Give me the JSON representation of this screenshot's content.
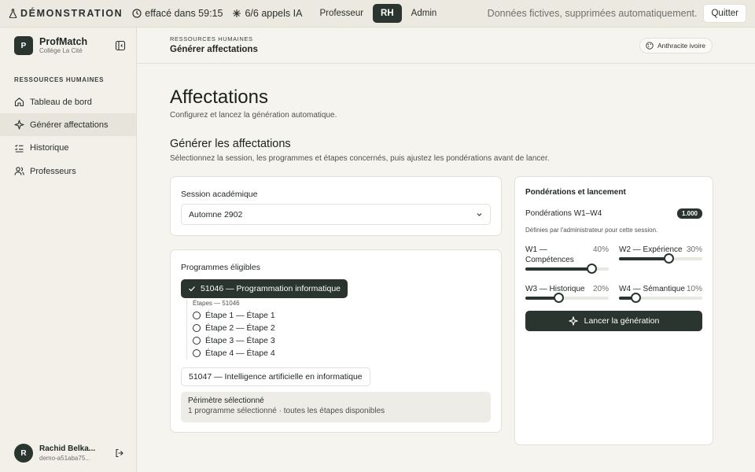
{
  "topbar": {
    "demo_label": "DÉMONSTRATION",
    "timer": "effacé dans 59:15",
    "ai_calls": "6/6 appels IA",
    "roles": [
      "Professeur",
      "RH",
      "Admin"
    ],
    "active_role": "RH",
    "note": "Données fictives, supprimées automatiquement.",
    "quit_label": "Quitter"
  },
  "brand": {
    "logo": "P",
    "name": "ProfMatch",
    "sub": "Collège La Cité"
  },
  "sidebar": {
    "section": "RESSOURCES HUMAINES",
    "items": [
      {
        "label": "Tableau de bord",
        "icon": "home-icon"
      },
      {
        "label": "Générer affectations",
        "icon": "sparkle-icon",
        "active": true
      },
      {
        "label": "Historique",
        "icon": "checklist-icon"
      },
      {
        "label": "Professeurs",
        "icon": "users-icon"
      }
    ]
  },
  "user": {
    "initial": "R",
    "name": "Rachid Belka...",
    "id": "demo-a51aba75..."
  },
  "header": {
    "section": "RESSOURCES HUMAINES",
    "page": "Générer affectations",
    "theme_label": "Anthracite ivoire"
  },
  "page": {
    "title": "Affectations",
    "subtitle": "Configurez et lancez la génération automatique.",
    "section_title": "Générer les affectations",
    "section_subtitle": "Sélectionnez la session, les programmes et étapes concernés, puis ajustez les pondérations avant de lancer."
  },
  "session": {
    "label": "Session académique",
    "value": "Automne 2902"
  },
  "programs": {
    "label": "Programmes éligibles",
    "selected": "51046 — Programmation informatique",
    "steps_label": "Étapes — 51046",
    "steps": [
      "Étape 1 — Étape 1",
      "Étape 2 — Étape 2",
      "Étape 3 — Étape 3",
      "Étape 4 — Étape 4"
    ],
    "other": "51047 — Intelligence artificielle en informatique",
    "perimeter_title": "Périmètre sélectionné",
    "perimeter_desc": "1 programme sélectionné · toutes les étapes disponibles"
  },
  "weights": {
    "title": "Pondérations et lancement",
    "head": "Pondérations W1–W4",
    "total": "1.000",
    "note": "Définies par l'administrateur pour cette session.",
    "items": [
      {
        "label": "W1 — Compétences",
        "pct": "40%",
        "value": 0.4
      },
      {
        "label": "W2 — Expérience",
        "pct": "30%",
        "value": 0.3
      },
      {
        "label": "W3 — Historique",
        "pct": "20%",
        "value": 0.2
      },
      {
        "label": "W4 — Sémantique",
        "pct": "10%",
        "value": 0.1
      }
    ],
    "launch_label": "Lancer la génération"
  }
}
